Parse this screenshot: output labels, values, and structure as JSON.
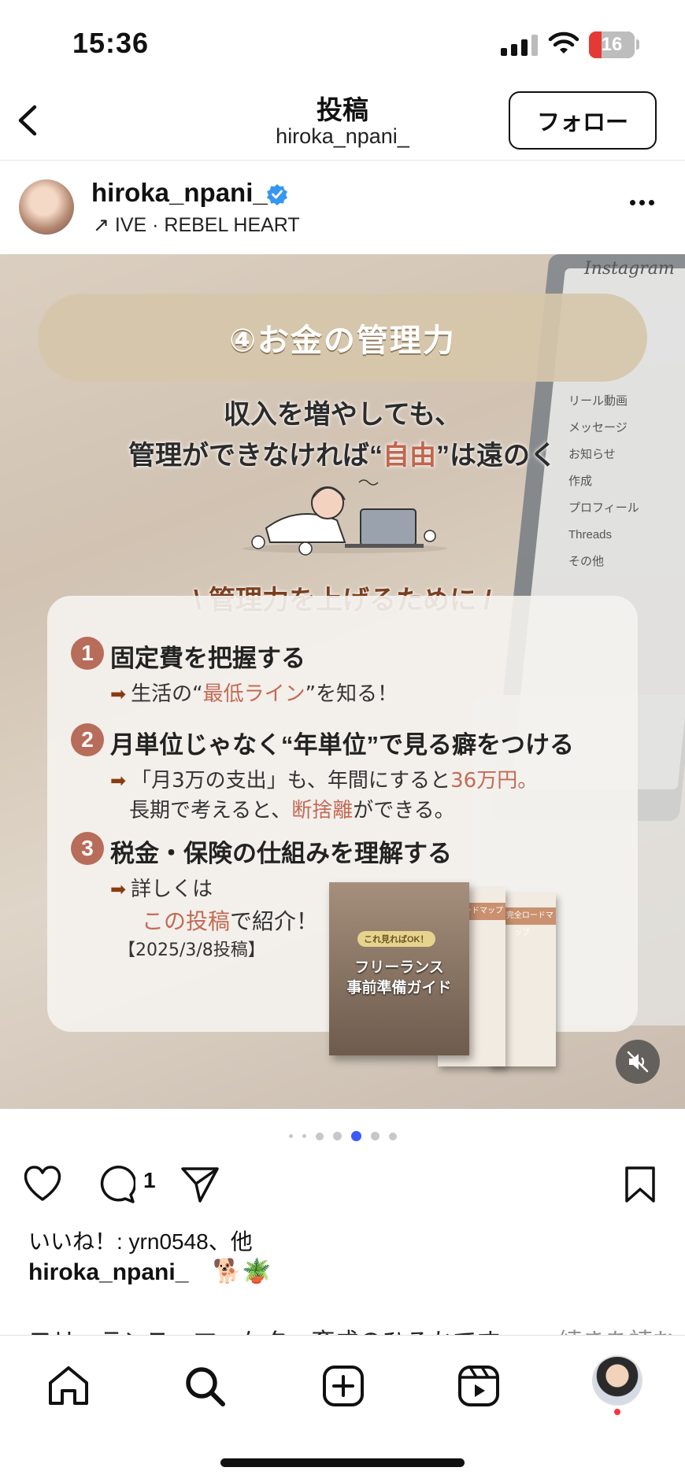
{
  "status_bar": {
    "time": "15:36",
    "battery": "16"
  },
  "header": {
    "title": "投稿",
    "subtitle": "hiroka_npani_",
    "follow_label": "フォロー"
  },
  "post": {
    "username": "hiroka_npani_",
    "music": "↗ IVE · REBEL HEART",
    "image": {
      "screen_brand": "Instagram",
      "screen_menu": [
        "リール動画",
        "メッセージ",
        "お知らせ",
        "作成",
        "プロフィール",
        "Threads",
        "その他"
      ],
      "title": "④お金の管理力",
      "intro_line1": "収入を増やしても、",
      "intro_line2_a": "管理ができなければ“",
      "intro_line2_accent": "自由",
      "intro_line2_b": "”は遠のく",
      "section_title": "\\ 管理力を上げるために /",
      "tips": [
        {
          "num": "1",
          "heading": "固定費を把握する",
          "line1_a": "生活の“",
          "line1_hl": "最低ライン",
          "line1_b": "”を知る！"
        },
        {
          "num": "2",
          "heading": "月単位じゃなく“年単位”で見る癖をつける",
          "line1_a": "「月3万の支出」も、年間にすると",
          "line1_hl": "36万円。",
          "line2_a": "長期で考えると、",
          "line2_hl": "断捨離",
          "line2_b": "ができる。"
        },
        {
          "num": "3",
          "heading": "税金・保険の仕組みを理解する",
          "line1": "詳しくは",
          "line2_hl": "この投稿",
          "line2_b": "で紹介！",
          "line3": "【2025/3/8投稿】"
        }
      ],
      "guide_badge": "これ見ればOK！",
      "guide_title_1": "フリーランス",
      "guide_title_2": "事前準備ガイド",
      "doc1_head": "完全ロードマップ",
      "doc2_head": "ンス完全ロードマップ"
    },
    "carousel": {
      "count": 7,
      "active_index": 4
    },
    "comment_count": "1",
    "likes_text": "いいね！: yrn0548、他",
    "caption_user": "hiroka_npani_",
    "caption_emoji": "🐕🪴",
    "caption_text": "フリーランス・マーケター育成のひろかです。",
    "caption_more": "続きを読む"
  },
  "tabs": [
    "home-icon",
    "search-icon",
    "create-icon",
    "reels-icon",
    "profile-avatar"
  ]
}
